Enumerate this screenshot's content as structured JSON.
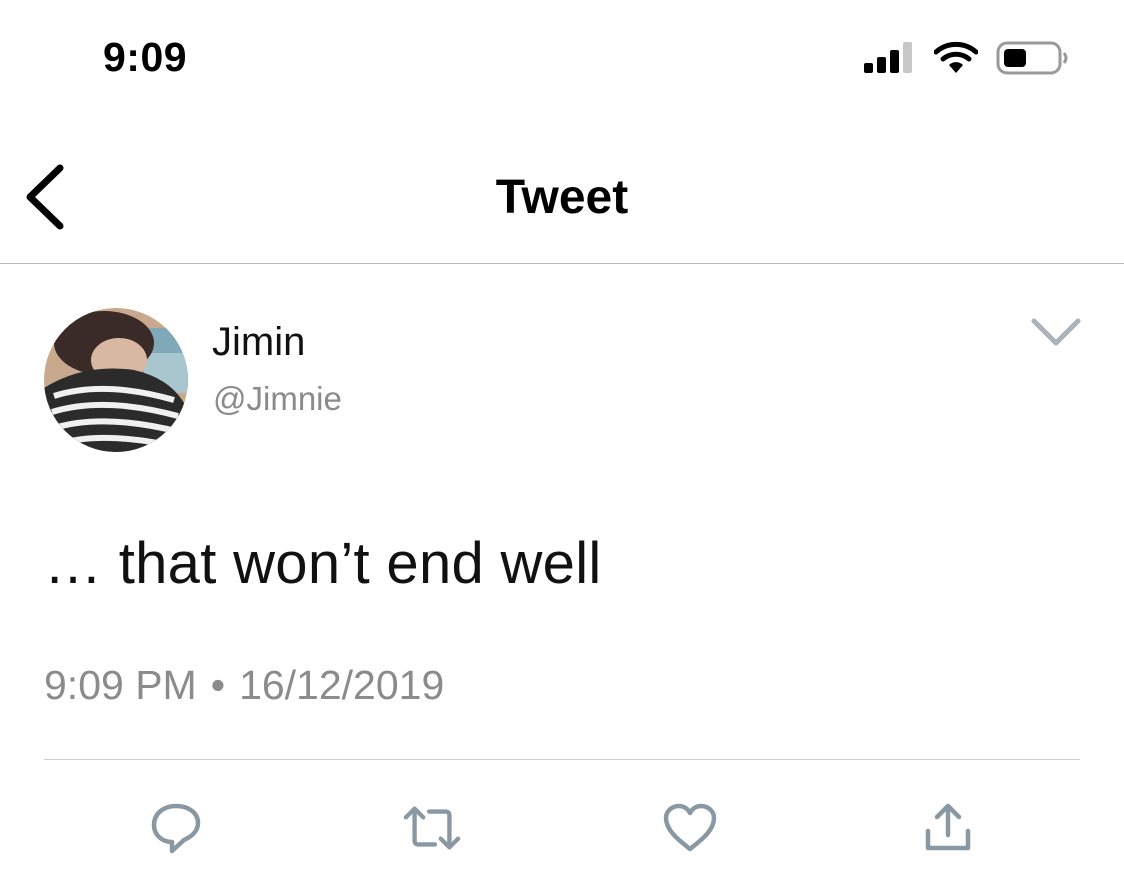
{
  "status_bar": {
    "time": "9:09",
    "icons": [
      "cellular-signal-icon",
      "wifi-icon",
      "battery-icon"
    ]
  },
  "nav": {
    "back_icon": "chevron-left-icon",
    "title": "Tweet"
  },
  "tweet": {
    "author": {
      "name": "Jimin",
      "handle": "@Jimnie"
    },
    "more_icon": "chevron-down-icon",
    "text": "… that won’t end well",
    "time": "9:09 PM",
    "separator": "•",
    "date": "16/12/2019"
  },
  "actions": [
    {
      "name": "reply",
      "icon": "reply-icon"
    },
    {
      "name": "retweet",
      "icon": "retweet-icon"
    },
    {
      "name": "like",
      "icon": "heart-icon"
    },
    {
      "name": "share",
      "icon": "share-icon"
    }
  ],
  "colors": {
    "text": "#111111",
    "secondary_text": "#8b8b8b",
    "icon_gray": "#8a98a3",
    "divider": "#bdbdbd"
  }
}
